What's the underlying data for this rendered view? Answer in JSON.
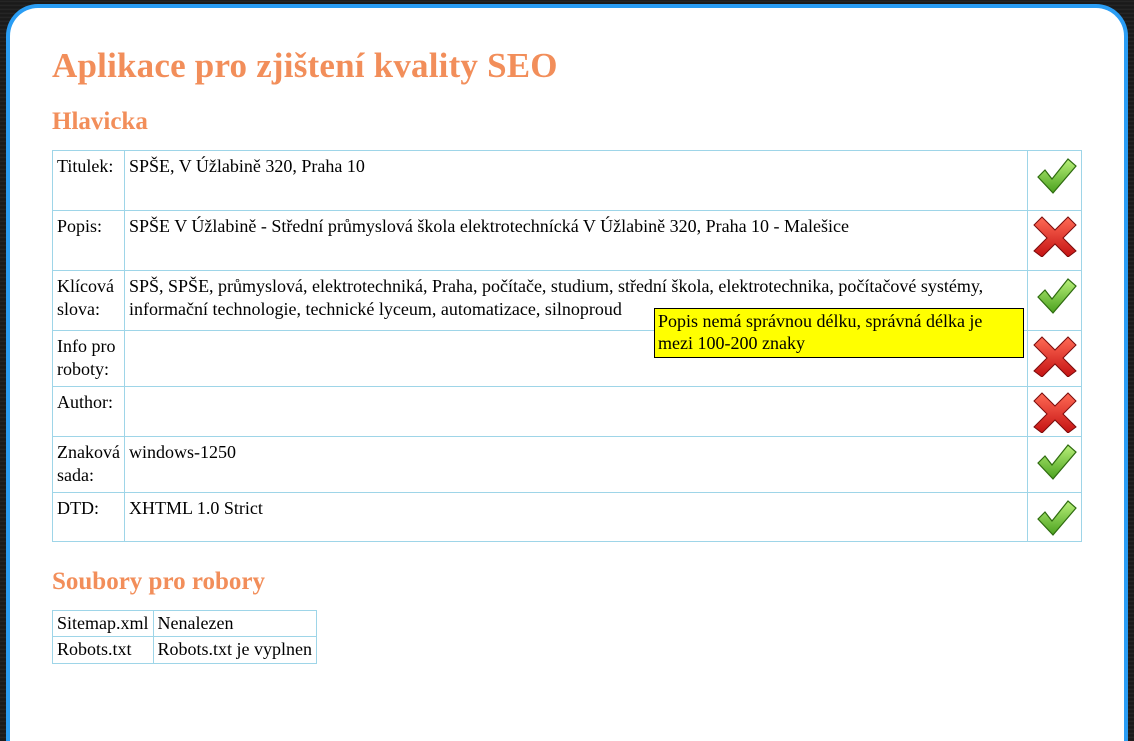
{
  "page": {
    "title": "Aplikace pro zjištení kvality SEO"
  },
  "sections": {
    "header": {
      "title": "Hlavicka",
      "rows": [
        {
          "label": "Titulek:",
          "value": "SPŠE, V Úžlabině 320, Praha 10",
          "status": "ok"
        },
        {
          "label": "Popis:",
          "value": "SPŠE V Úžlabině - Střední průmyslová škola elektrotechnícká V Úžlabině 320, Praha 10 - Malešice",
          "status": "bad"
        },
        {
          "label": "Klícová slova:",
          "value": "SPŠ, SPŠE, průmyslová, elektrotechniká, Praha, počítače, studium, střední škola, elektrotechnika, počítačové systémy, informační technologie, technické lyceum, automatizace, silnoproud",
          "status": "ok"
        },
        {
          "label": "Info pro roboty:",
          "value": "",
          "status": "bad"
        },
        {
          "label": "Author:",
          "value": "",
          "status": "bad"
        },
        {
          "label": "Znaková sada:",
          "value": "windows-1250",
          "status": "ok"
        },
        {
          "label": "DTD:",
          "value": "XHTML 1.0 Strict",
          "status": "ok"
        }
      ]
    },
    "robots": {
      "title": "Soubory pro robory",
      "rows": [
        {
          "label": "Sitemap.xml",
          "value": "Nenalezen"
        },
        {
          "label": "Robots.txt",
          "value": "Robots.txt je vyplnen"
        }
      ]
    }
  },
  "tooltip": {
    "text": "Popis nemá správnou délku, správná délka je mezi 100-200 znaky"
  }
}
